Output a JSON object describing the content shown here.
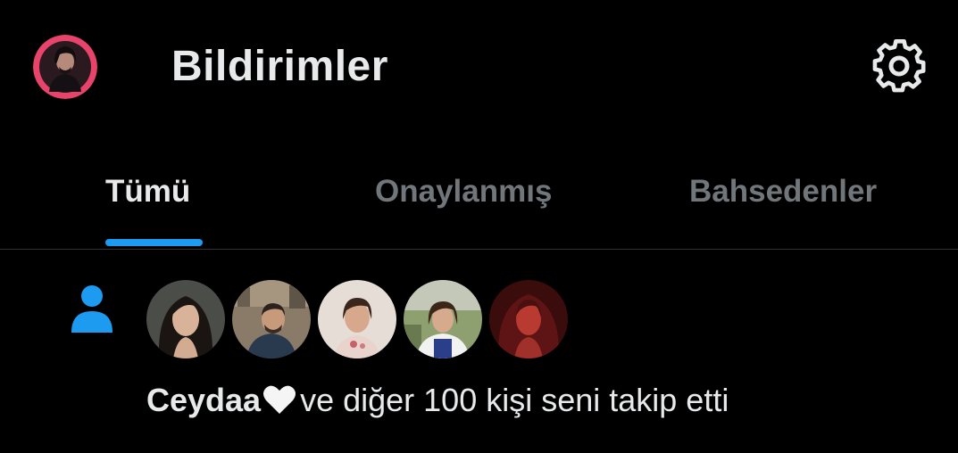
{
  "header": {
    "title": "Bildirimler",
    "avatar_icon": "profile-avatar",
    "settings_icon": "gear-icon"
  },
  "tabs": [
    {
      "label": "Tümü",
      "active": true
    },
    {
      "label": "Onaylanmış",
      "active": false
    },
    {
      "label": "Bahsedenler",
      "active": false
    }
  ],
  "notification": {
    "type_icon": "person-icon",
    "avatar_count_shown": 5,
    "name": "Ceydaa",
    "name_emoji": "white-heart-icon",
    "text": "ve diğer 100 kişi seni takip etti"
  },
  "colors": {
    "background": "#000000",
    "text_primary": "#e7e9ea",
    "text_secondary": "#71767b",
    "accent": "#1d9bf0",
    "divider": "#2f3336",
    "avatar_ring": "#e8436b"
  }
}
